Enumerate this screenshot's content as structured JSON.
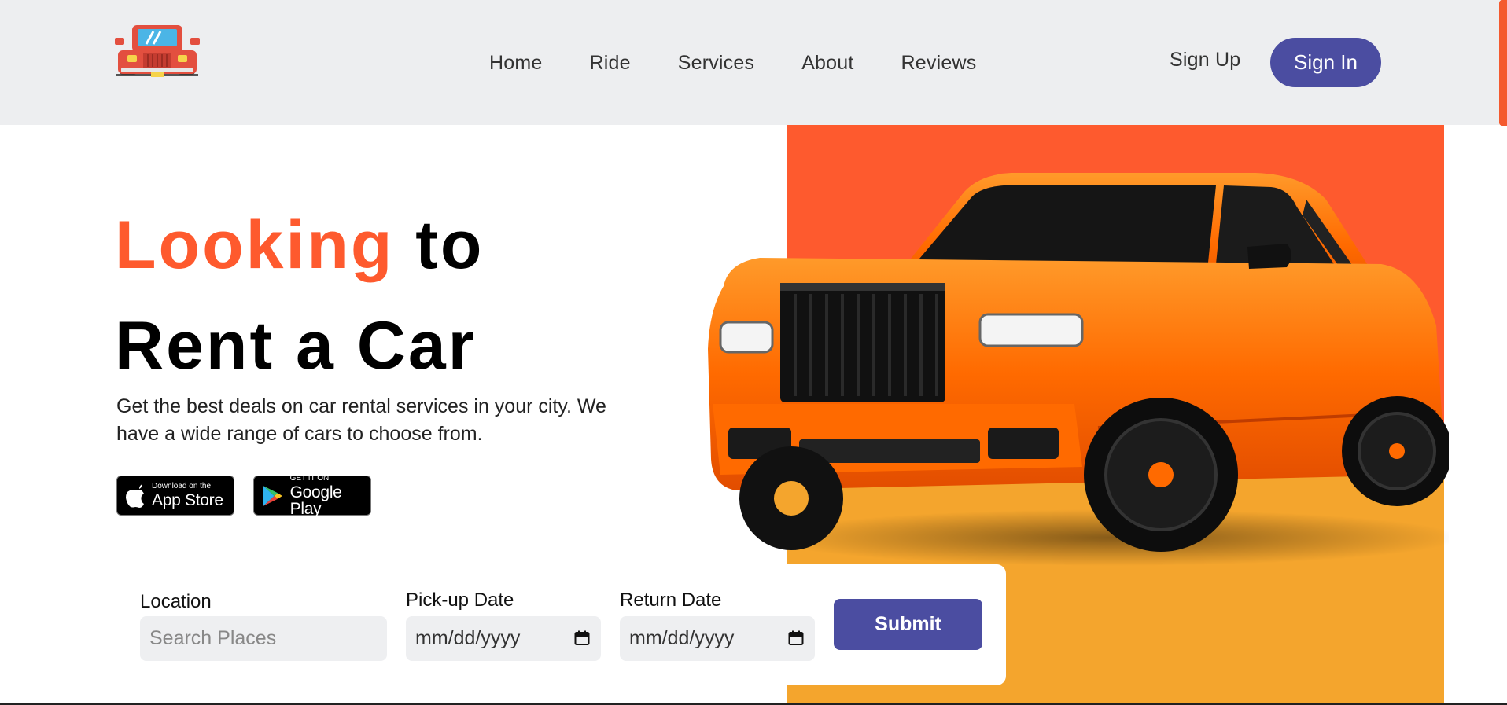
{
  "header": {
    "logo_icon": "jeep-icon",
    "nav": [
      "Home",
      "Ride",
      "Services",
      "About",
      "Reviews"
    ],
    "signup_label": "Sign Up",
    "signin_label": "Sign In"
  },
  "hero": {
    "headline_accent": "Looking",
    "headline_rest": " to",
    "headline_line2": "Rent a Car",
    "subtext": "Get the best deals on car rental services in your city. We have a wide range of cars to choose from.",
    "car_image": "orange-suv-image",
    "appstore": {
      "small": "Download on the",
      "big": "App Store"
    },
    "googleplay": {
      "small": "GET IT ON",
      "big": "Google Play"
    }
  },
  "form": {
    "location_label": "Location",
    "location_placeholder": "Search Places",
    "pickup_label": "Pick-up Date",
    "pickup_value": "mm/dd/yyyy",
    "return_label": "Return Date",
    "return_value": "mm/dd/yyyy",
    "submit_label": "Submit"
  },
  "colors": {
    "accent": "#fe5a2e",
    "primary": "#4b4da1",
    "yellow": "#f4a52d",
    "header_bg": "#edeef0"
  }
}
